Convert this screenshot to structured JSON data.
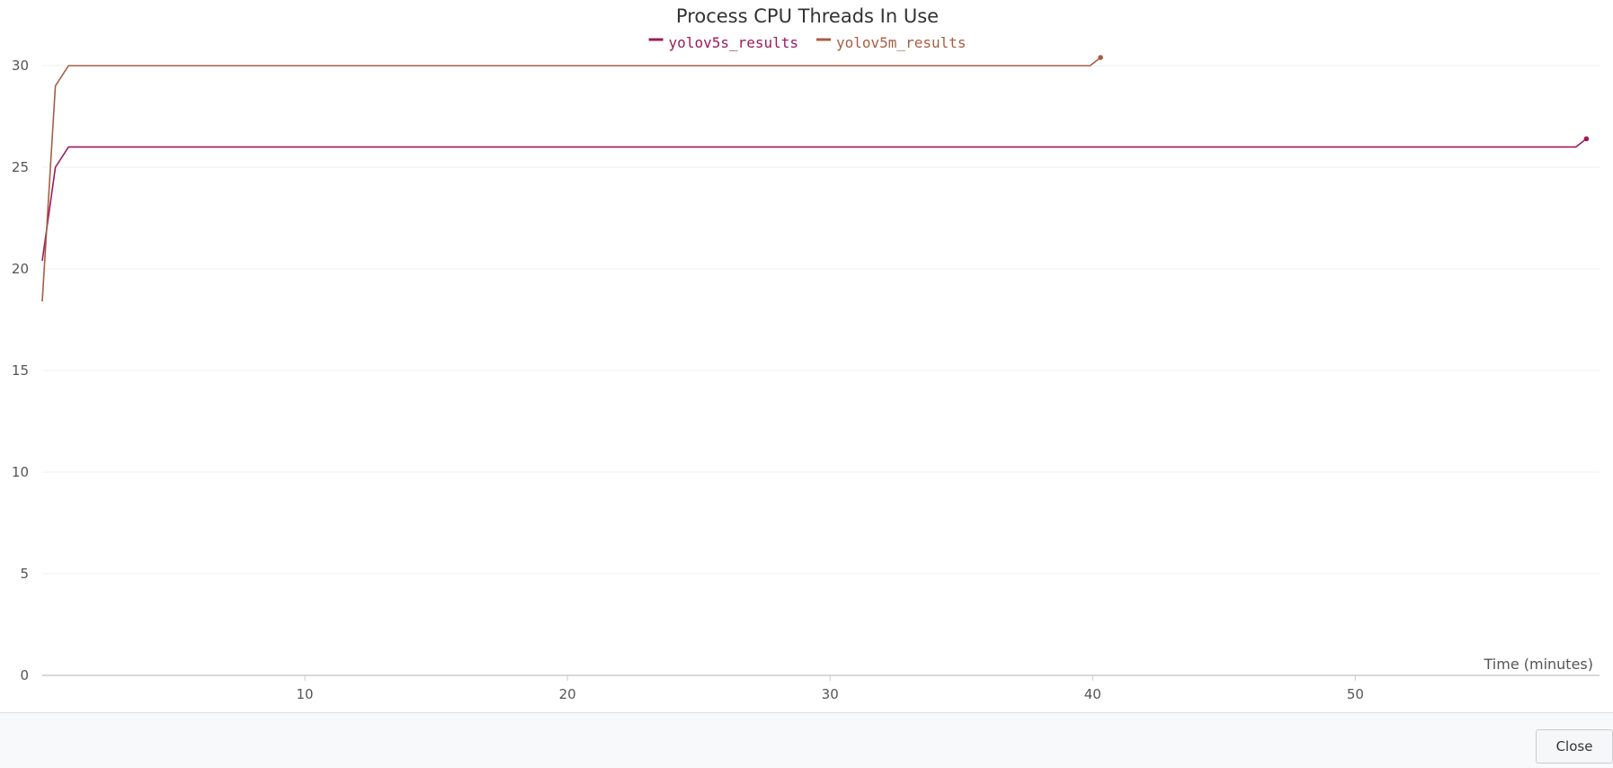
{
  "chart_data": {
    "type": "line",
    "title": "Process CPU Threads In Use",
    "xlabel": "Time (minutes)",
    "ylabel": "",
    "xlim": [
      0,
      59.3
    ],
    "ylim": [
      0,
      30
    ],
    "xticks": [
      10,
      20,
      30,
      40,
      50
    ],
    "yticks": [
      0,
      5,
      10,
      15,
      20,
      25,
      30
    ],
    "grid": true,
    "legend_position": "top-center",
    "series": [
      {
        "name": "yolov5s_results",
        "color": "#9b1b5a",
        "x": [
          0,
          0.5,
          1.0,
          58.4,
          58.8
        ],
        "y": [
          20.4,
          25,
          26,
          26,
          26.4
        ],
        "end_marker": true
      },
      {
        "name": "yolov5m_results",
        "color": "#a65e44",
        "x": [
          0,
          0.5,
          1.0,
          39.9,
          40.3
        ],
        "y": [
          18.4,
          29,
          30,
          30,
          30.4
        ],
        "end_marker": true
      }
    ]
  },
  "footer": {
    "close_label": "Close"
  }
}
